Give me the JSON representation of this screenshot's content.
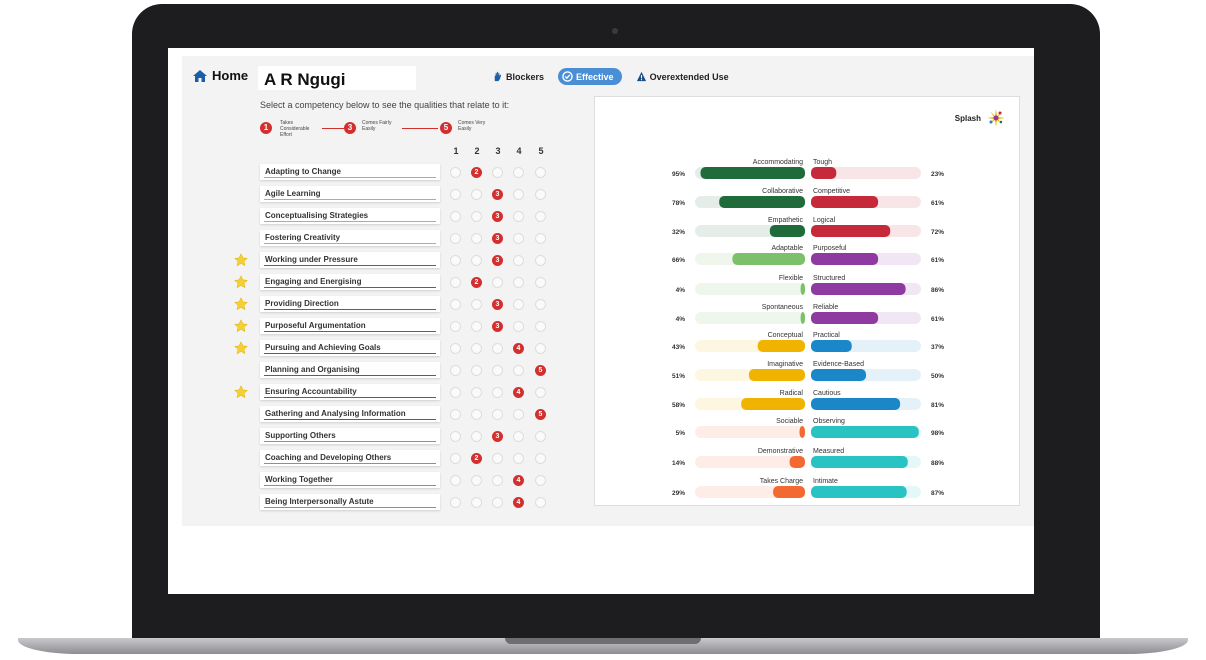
{
  "app": {
    "home_label": "Home",
    "person_name": "A R Ngugi",
    "filters": [
      {
        "label": "Blockers",
        "icon": "hand-icon",
        "active": false
      },
      {
        "label": "Effective",
        "icon": "check-circle-icon",
        "active": true
      },
      {
        "label": "Overextended Use",
        "icon": "warning-icon",
        "active": false
      }
    ],
    "instruction": "Select a competency below to see the qualities that relate to it:",
    "scale": {
      "points": [
        {
          "num": "1",
          "label": "Takes Considerable Effort"
        },
        {
          "num": "3",
          "label": "Comes Fairly Easily"
        },
        {
          "num": "5",
          "label": "Comes Very Easily"
        }
      ],
      "columns": [
        "1",
        "2",
        "3",
        "4",
        "5"
      ]
    },
    "competencies": [
      {
        "label": "Adapting to Change",
        "rating": 2,
        "star": false,
        "color": "#e8a23a"
      },
      {
        "label": "Agile Learning",
        "rating": 3,
        "star": false,
        "color": "#e8a23a"
      },
      {
        "label": "Conceptualising Strategies",
        "rating": 3,
        "star": false,
        "color": "#e8a23a"
      },
      {
        "label": "Fostering Creativity",
        "rating": 3,
        "star": false,
        "color": "#e8a23a"
      },
      {
        "label": "Working under Pressure",
        "rating": 3,
        "star": true,
        "color": "#d32f2f"
      },
      {
        "label": "Engaging and Energising",
        "rating": 2,
        "star": true,
        "color": "#d32f2f"
      },
      {
        "label": "Providing Direction",
        "rating": 3,
        "star": true,
        "color": "#d32f2f"
      },
      {
        "label": "Purposeful Argumentation",
        "rating": 3,
        "star": true,
        "color": "#d32f2f"
      },
      {
        "label": "Pursuing and Achieving Goals",
        "rating": 4,
        "star": true,
        "color": "#5b4fb0"
      },
      {
        "label": "Planning and Organising",
        "rating": 5,
        "star": false,
        "color": "#5b4fb0"
      },
      {
        "label": "Ensuring Accountability",
        "rating": 4,
        "star": true,
        "color": "#5b4fb0"
      },
      {
        "label": "Gathering and Analysing Information",
        "rating": 5,
        "star": false,
        "color": "#5b4fb0"
      },
      {
        "label": "Supporting Others",
        "rating": 3,
        "star": false,
        "color": "#7ea646"
      },
      {
        "label": "Coaching and Developing Others",
        "rating": 2,
        "star": false,
        "color": "#7ea646"
      },
      {
        "label": "Working Together",
        "rating": 4,
        "star": false,
        "color": "#7ea646"
      },
      {
        "label": "Being Interpersonally Astute",
        "rating": 4,
        "star": false,
        "color": "#7ea646"
      }
    ],
    "splash_label": "Splash"
  },
  "chart_data": {
    "type": "bar",
    "pairs": [
      {
        "left": "Accommodating",
        "left_value": 95,
        "right": "Tough",
        "right_value": 23,
        "left_color": "#1f6b3a",
        "right_color": "#c62a3a"
      },
      {
        "left": "Collaborative",
        "left_value": 78,
        "right": "Competitive",
        "right_value": 61,
        "left_color": "#1f6b3a",
        "right_color": "#c62a3a"
      },
      {
        "left": "Empathetic",
        "left_value": 32,
        "right": "Logical",
        "right_value": 72,
        "left_color": "#1f6b3a",
        "right_color": "#c62a3a"
      },
      {
        "left": "Adaptable",
        "left_value": 66,
        "right": "Purposeful",
        "right_value": 61,
        "left_color": "#7cc06b",
        "right_color": "#8e3aa0"
      },
      {
        "left": "Flexible",
        "left_value": 4,
        "right": "Structured",
        "right_value": 86,
        "left_color": "#7cc06b",
        "right_color": "#8e3aa0"
      },
      {
        "left": "Spontaneous",
        "left_value": 4,
        "right": "Reliable",
        "right_value": 61,
        "left_color": "#7cc06b",
        "right_color": "#8e3aa0"
      },
      {
        "left": "Conceptual",
        "left_value": 43,
        "right": "Practical",
        "right_value": 37,
        "left_color": "#f0b400",
        "right_color": "#1b87c9"
      },
      {
        "left": "Imaginative",
        "left_value": 51,
        "right": "Evidence-Based",
        "right_value": 50,
        "left_color": "#f0b400",
        "right_color": "#1b87c9"
      },
      {
        "left": "Radical",
        "left_value": 58,
        "right": "Cautious",
        "right_value": 81,
        "left_color": "#f0b400",
        "right_color": "#1b87c9"
      },
      {
        "left": "Sociable",
        "left_value": 5,
        "right": "Observing",
        "right_value": 98,
        "left_color": "#f26a32",
        "right_color": "#2ac3c3"
      },
      {
        "left": "Demonstrative",
        "left_value": 14,
        "right": "Measured",
        "right_value": 88,
        "left_color": "#f26a32",
        "right_color": "#2ac3c3"
      },
      {
        "left": "Takes Charge",
        "left_value": 29,
        "right": "Intimate",
        "right_value": 87,
        "left_color": "#f26a32",
        "right_color": "#2ac3c3"
      }
    ],
    "xlim": [
      0,
      100
    ]
  }
}
